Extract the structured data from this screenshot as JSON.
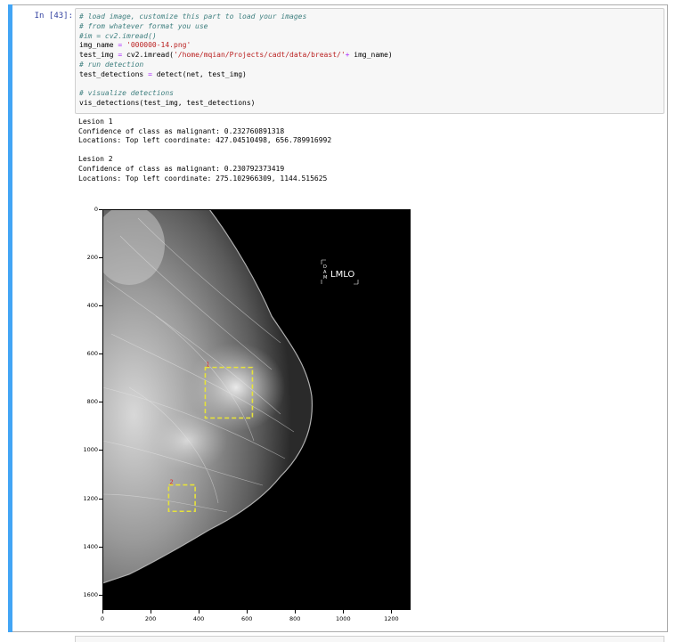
{
  "cell": {
    "prompt": "In [43]:",
    "code_lines": [
      {
        "parts": [
          {
            "t": "# load image, customize this part to load your images",
            "c": "cm-comment"
          }
        ]
      },
      {
        "parts": [
          {
            "t": "# from whatever format you use",
            "c": "cm-comment"
          }
        ]
      },
      {
        "parts": [
          {
            "t": "#im = cv2.imread()",
            "c": "cm-comment"
          }
        ]
      },
      {
        "parts": [
          {
            "t": "img_name ",
            "c": ""
          },
          {
            "t": "=",
            "c": "cm-op"
          },
          {
            "t": " ",
            "c": ""
          },
          {
            "t": "'000000-14.png'",
            "c": "cm-string"
          }
        ]
      },
      {
        "parts": [
          {
            "t": "test_img ",
            "c": ""
          },
          {
            "t": "=",
            "c": "cm-op"
          },
          {
            "t": " cv2.imread(",
            "c": ""
          },
          {
            "t": "'/home/mqian/Projects/cadt/data/breast/'",
            "c": "cm-string"
          },
          {
            "t": "+",
            "c": "cm-op"
          },
          {
            "t": " img_name)",
            "c": ""
          }
        ]
      },
      {
        "parts": [
          {
            "t": "# run detection",
            "c": "cm-comment"
          }
        ]
      },
      {
        "parts": [
          {
            "t": "test_detections ",
            "c": ""
          },
          {
            "t": "=",
            "c": "cm-op"
          },
          {
            "t": " detect(net, test_img)",
            "c": ""
          }
        ]
      },
      {
        "parts": [
          {
            "t": "",
            "c": ""
          }
        ]
      },
      {
        "parts": [
          {
            "t": "# visualize detections",
            "c": "cm-comment"
          }
        ]
      },
      {
        "parts": [
          {
            "t": "vis_detections(test_img, test_detections)",
            "c": ""
          }
        ]
      }
    ]
  },
  "output": {
    "lines": [
      "Lesion 1",
      "Confidence of class as malignant: 0.232760891318",
      "Locations: Top left coordinate: 427.04510498, 656.789916992",
      "",
      "Lesion 2",
      "Confidence of class as malignant: 0.230792373419",
      "Locations: Top left coordinate: 275.102966309, 1144.515625"
    ]
  },
  "figure": {
    "y_ticks": [
      "0",
      "200",
      "400",
      "600",
      "800",
      "1000",
      "1200",
      "1400",
      "1600"
    ],
    "x_ticks": [
      "0",
      "200",
      "400",
      "600",
      "800",
      "1000",
      "1200"
    ],
    "view_label": "LMLO",
    "orientation_letters": [
      "D",
      "A",
      "M"
    ],
    "detections": [
      {
        "label": "1",
        "x": 427.04510498,
        "y": 656.789916992,
        "w": 196,
        "h": 210
      },
      {
        "label": "2",
        "x": 275.102966309,
        "y": 1144.515625,
        "w": 110,
        "h": 110
      }
    ],
    "box_color": "#e6e23a",
    "label_color": "#d9302a"
  }
}
